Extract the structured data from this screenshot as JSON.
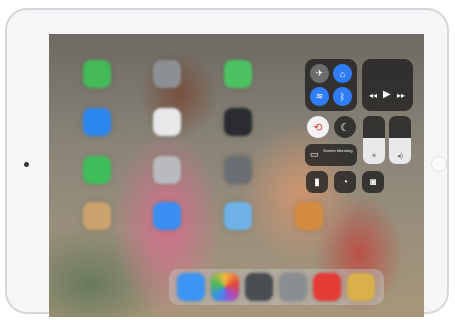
{
  "device": {
    "type": "iPad",
    "orientation": "landscape"
  },
  "control_center": {
    "screen_mirroring_label": "Screen Mirroring",
    "brightness_level": 0.55,
    "volume_level": 0.55,
    "toggles": [
      "airplane-mode",
      "cellular",
      "wifi",
      "bluetooth",
      "orientation-lock",
      "do-not-disturb"
    ],
    "shortcuts": [
      "flashlight",
      "timer",
      "camera"
    ],
    "media_controls": [
      "previous",
      "play",
      "next"
    ]
  },
  "colors": {
    "tile_dark": "#1e1e1e",
    "toggle_blue": "#2f7cf6",
    "toggle_red": "#e0453a",
    "slider_fill": "#e9e9ec",
    "bezel": "#f6f6f8"
  },
  "home_icons": [
    "messages",
    "app",
    "facetime",
    "app",
    "app",
    "app",
    "app",
    "app",
    "app",
    "mail",
    "app",
    "app"
  ],
  "dock_icons": [
    "safari",
    "photos",
    "app",
    "settings",
    "youtube",
    "app"
  ]
}
